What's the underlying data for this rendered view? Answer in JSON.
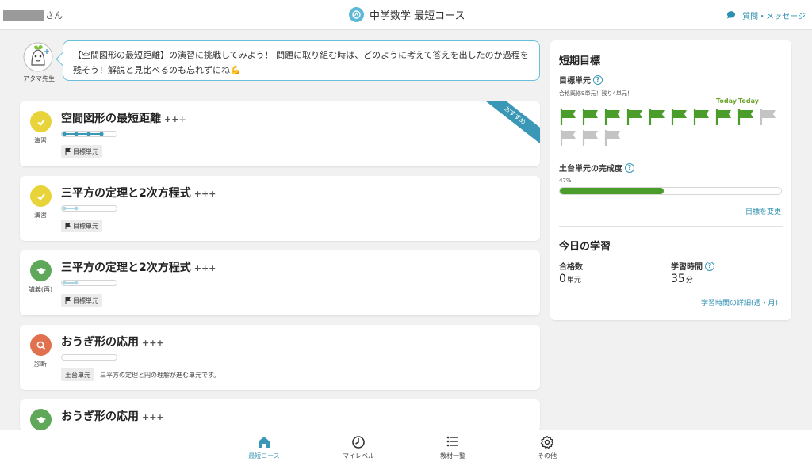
{
  "header": {
    "user_suffix": "さん",
    "course_title": "中学数学 最短コース",
    "message_label": "質問・メッセージ"
  },
  "advice": {
    "name": "アタマ先生",
    "text": "【空間図形の最短距離】の演習に挑戦してみよう！ 問題に取り組む時は、どのように考えて答えを出したのか過程を残そう！解説と見比べるのも忘れずにね💪"
  },
  "units": [
    {
      "title": "空間図形の最短距離",
      "level_on": "++",
      "level_off": "+",
      "type": "演習",
      "badge_color": "#e8d43a",
      "tag": "目標単元",
      "ribbon": "おすすめ"
    },
    {
      "title": "三平方の定理と2次方程式",
      "level_on": "+++",
      "level_off": "",
      "type": "演習",
      "badge_color": "#e8d43a",
      "tag": "目標単元"
    },
    {
      "title": "三平方の定理と2次方程式",
      "level_on": "+++",
      "level_off": "",
      "type": "講義(再)",
      "badge_color": "#5fa85a",
      "tag": "目標単元"
    },
    {
      "title": "おうぎ形の応用",
      "level_on": "+++",
      "level_off": "",
      "type": "診断",
      "badge_color": "#e0704e",
      "tag": "土台単元",
      "description": "三平方の定理と円の理解が進む単元です。"
    },
    {
      "title": "おうぎ形の応用",
      "level_on": "+++",
      "level_off": "",
      "type": "",
      "badge_color": "#5fa85a"
    }
  ],
  "short_goal": {
    "title": "短期目標",
    "goal_label": "目標単元",
    "goal_status": "合格既修9単元！残り4単元！",
    "today_labels": [
      "Today",
      "Today"
    ],
    "flags_done": 9,
    "flags_total": 13,
    "completion_label": "土台単元の完成度",
    "completion_percent_text": "47%",
    "completion_fraction": 0.47,
    "change_link": "目標を変更"
  },
  "today": {
    "title": "今日の学習",
    "pass_label": "合格数",
    "pass_value": "0",
    "pass_unit": "単元",
    "time_label": "学習時間",
    "time_value": "35",
    "time_unit": "分",
    "detail_link": "学習時間の詳細(週・月)"
  },
  "nav": [
    {
      "label": "最短コース",
      "icon": "home-icon"
    },
    {
      "label": "マイレベル",
      "icon": "clock-icon"
    },
    {
      "label": "教材一覧",
      "icon": "list-icon"
    },
    {
      "label": "その他",
      "icon": "gear-icon"
    }
  ],
  "colors": {
    "accent": "#3a97b5",
    "flag_done": "#4a9d2b",
    "flag_todo": "#c4c4c4"
  }
}
